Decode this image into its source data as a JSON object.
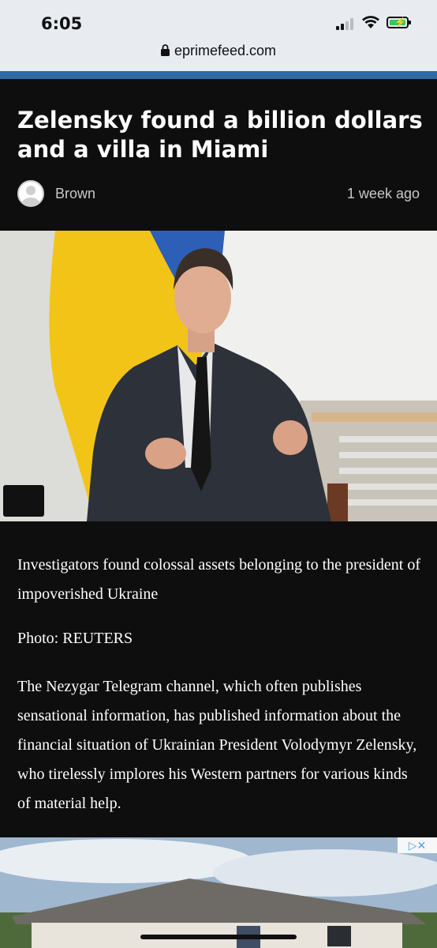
{
  "status_bar": {
    "time": "6:05"
  },
  "browser": {
    "url": "eprimefeed.com"
  },
  "article": {
    "headline": "Zelensky found a billion dollars and a villa in Miami",
    "author": "Brown",
    "date": "1 week ago",
    "paragraphs": [
      "Investigators found colossal assets belonging to the president of impoverished Ukraine",
      "Photo: REUTERS",
      "The Nezygar Telegram channel, which often publishes sensational information, has published information about the financial situation of Ukrainian President Volodymyr Zelensky, who tirelessly implores his Western partners for various kinds of material help."
    ]
  },
  "ad": {
    "badge": "▷✕"
  },
  "colors": {
    "accent": "#2f6aa3",
    "background": "#0e0e0e",
    "chrome": "#e8ecf1"
  }
}
